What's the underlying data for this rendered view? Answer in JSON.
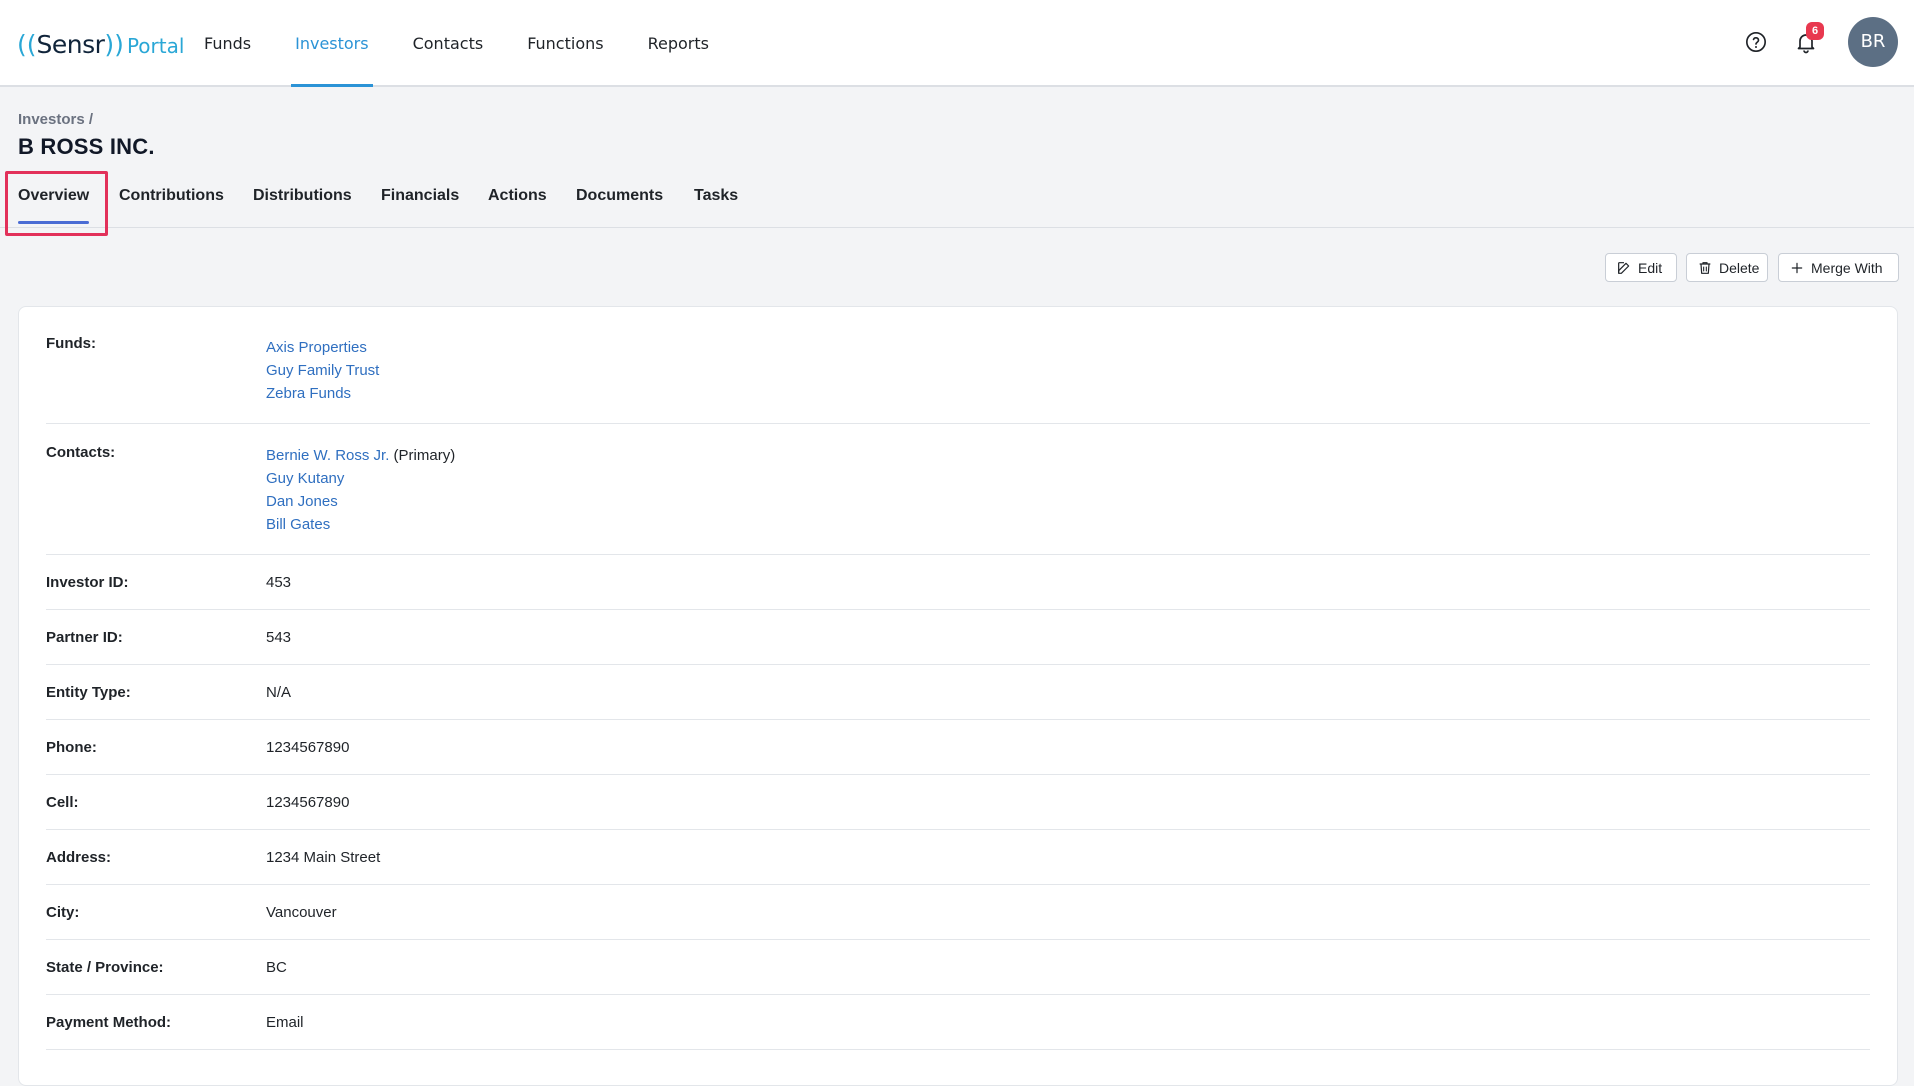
{
  "header": {
    "logo": {
      "brand": "Sensr",
      "product": "Portal"
    },
    "nav": [
      {
        "label": "Funds",
        "active": false
      },
      {
        "label": "Investors",
        "active": true
      },
      {
        "label": "Contacts",
        "active": false
      },
      {
        "label": "Functions",
        "active": false
      },
      {
        "label": "Reports",
        "active": false
      }
    ],
    "notifications_count": "6",
    "avatar_initials": "BR"
  },
  "breadcrumb": "Investors /",
  "page_title": "B ROSS INC.",
  "tabs": [
    {
      "label": "Overview",
      "active": true
    },
    {
      "label": "Contributions",
      "active": false
    },
    {
      "label": "Distributions",
      "active": false
    },
    {
      "label": "Financials",
      "active": false
    },
    {
      "label": "Actions",
      "active": false
    },
    {
      "label": "Documents",
      "active": false
    },
    {
      "label": "Tasks",
      "active": false
    }
  ],
  "actions": {
    "edit": "Edit",
    "delete": "Delete",
    "merge": "Merge With"
  },
  "details": {
    "funds_label": "Funds:",
    "funds": [
      "Axis Properties",
      "Guy Family Trust",
      "Zebra Funds"
    ],
    "contacts_label": "Contacts:",
    "contacts": [
      {
        "name": "Bernie W. Ross Jr.",
        "note": "(Primary)"
      },
      {
        "name": "Guy Kutany",
        "note": ""
      },
      {
        "name": "Dan Jones",
        "note": ""
      },
      {
        "name": "Bill Gates",
        "note": ""
      }
    ],
    "fields": [
      {
        "label": "Investor ID:",
        "value": "453"
      },
      {
        "label": "Partner ID:",
        "value": "543"
      },
      {
        "label": "Entity Type:",
        "value": "N/A"
      },
      {
        "label": "Phone:",
        "value": "1234567890"
      },
      {
        "label": "Cell:",
        "value": "1234567890"
      },
      {
        "label": "Address:",
        "value": "1234 Main Street"
      },
      {
        "label": "City:",
        "value": "Vancouver"
      },
      {
        "label": "State / Province:",
        "value": "BC"
      },
      {
        "label": "Payment Method:",
        "value": "Email"
      }
    ]
  },
  "colors": {
    "accent": "#2b93d6",
    "link": "#2f6fc0",
    "highlight": "#e2315a",
    "badge": "#e8384f"
  }
}
